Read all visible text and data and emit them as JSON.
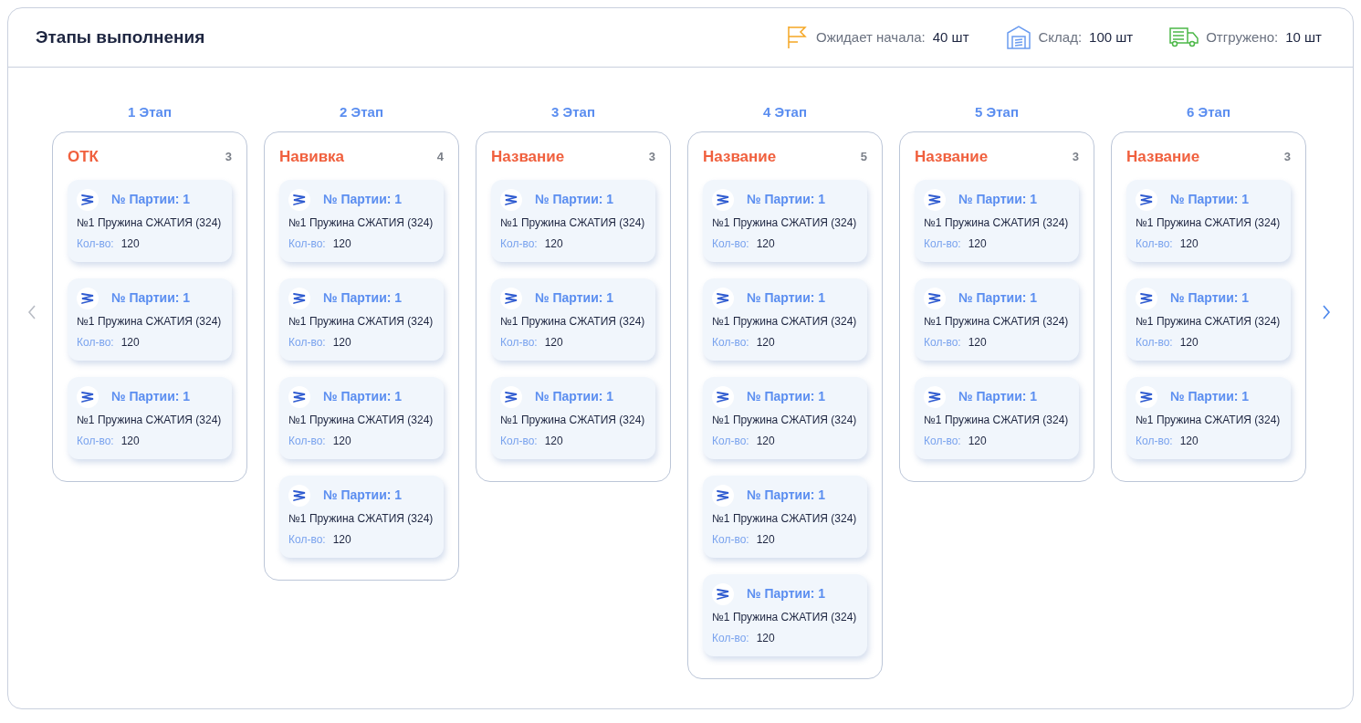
{
  "title": "Этапы выполнения",
  "summary": [
    {
      "kind": "waiting",
      "label": "Ожидает начала:",
      "value": "40 шт"
    },
    {
      "kind": "warehouse",
      "label": "Склад:",
      "value": "100 шт"
    },
    {
      "kind": "shipped",
      "label": "Отгружено:",
      "value": "10 шт"
    }
  ],
  "nav": {
    "prev_disabled": true,
    "next_disabled": false
  },
  "stages": [
    {
      "stage": "1 Этап",
      "name": "ОТК",
      "count": "3",
      "batches": [
        {
          "batch": "№ Партии: 1",
          "product": "№1 Пружина СЖАТИЯ (324)",
          "qty_label": "Кол-во:",
          "qty": "120"
        },
        {
          "batch": "№ Партии: 1",
          "product": "№1 Пружина СЖАТИЯ (324)",
          "qty_label": "Кол-во:",
          "qty": "120"
        },
        {
          "batch": "№ Партии: 1",
          "product": "№1 Пружина СЖАТИЯ (324)",
          "qty_label": "Кол-во:",
          "qty": "120"
        }
      ]
    },
    {
      "stage": "2 Этап",
      "name": "Навивка",
      "count": "4",
      "batches": [
        {
          "batch": "№ Партии: 1",
          "product": "№1 Пружина СЖАТИЯ (324)",
          "qty_label": "Кол-во:",
          "qty": "120"
        },
        {
          "batch": "№ Партии: 1",
          "product": "№1 Пружина СЖАТИЯ (324)",
          "qty_label": "Кол-во:",
          "qty": "120"
        },
        {
          "batch": "№ Партии: 1",
          "product": "№1 Пружина СЖАТИЯ (324)",
          "qty_label": "Кол-во:",
          "qty": "120"
        },
        {
          "batch": "№ Партии: 1",
          "product": "№1 Пружина СЖАТИЯ (324)",
          "qty_label": "Кол-во:",
          "qty": "120"
        }
      ]
    },
    {
      "stage": "3 Этап",
      "name": "Название",
      "count": "3",
      "batches": [
        {
          "batch": "№ Партии: 1",
          "product": "№1 Пружина СЖАТИЯ (324)",
          "qty_label": "Кол-во:",
          "qty": "120"
        },
        {
          "batch": "№ Партии: 1",
          "product": "№1 Пружина СЖАТИЯ (324)",
          "qty_label": "Кол-во:",
          "qty": "120"
        },
        {
          "batch": "№ Партии: 1",
          "product": "№1 Пружина СЖАТИЯ (324)",
          "qty_label": "Кол-во:",
          "qty": "120"
        }
      ]
    },
    {
      "stage": "4 Этап",
      "name": "Название",
      "count": "5",
      "batches": [
        {
          "batch": "№ Партии: 1",
          "product": "№1 Пружина СЖАТИЯ (324)",
          "qty_label": "Кол-во:",
          "qty": "120"
        },
        {
          "batch": "№ Партии: 1",
          "product": "№1 Пружина СЖАТИЯ (324)",
          "qty_label": "Кол-во:",
          "qty": "120"
        },
        {
          "batch": "№ Партии: 1",
          "product": "№1 Пружина СЖАТИЯ (324)",
          "qty_label": "Кол-во:",
          "qty": "120"
        },
        {
          "batch": "№ Партии: 1",
          "product": "№1 Пружина СЖАТИЯ (324)",
          "qty_label": "Кол-во:",
          "qty": "120"
        },
        {
          "batch": "№ Партии: 1",
          "product": "№1 Пружина СЖАТИЯ (324)",
          "qty_label": "Кол-во:",
          "qty": "120"
        }
      ]
    },
    {
      "stage": "5 Этап",
      "name": "Название",
      "count": "3",
      "batches": [
        {
          "batch": "№ Партии: 1",
          "product": "№1 Пружина СЖАТИЯ (324)",
          "qty_label": "Кол-во:",
          "qty": "120"
        },
        {
          "batch": "№ Партии: 1",
          "product": "№1 Пружина СЖАТИЯ (324)",
          "qty_label": "Кол-во:",
          "qty": "120"
        },
        {
          "batch": "№ Партии: 1",
          "product": "№1 Пружина СЖАТИЯ (324)",
          "qty_label": "Кол-во:",
          "qty": "120"
        }
      ]
    },
    {
      "stage": "6 Этап",
      "name": "Название",
      "count": "3",
      "batches": [
        {
          "batch": "№ Партии: 1",
          "product": "№1 Пружина СЖАТИЯ (324)",
          "qty_label": "Кол-во:",
          "qty": "120"
        },
        {
          "batch": "№ Партии: 1",
          "product": "№1 Пружина СЖАТИЯ (324)",
          "qty_label": "Кол-во:",
          "qty": "120"
        },
        {
          "batch": "№ Партии: 1",
          "product": "№1 Пружина СЖАТИЯ (324)",
          "qty_label": "Кол-во:",
          "qty": "120"
        }
      ]
    }
  ]
}
